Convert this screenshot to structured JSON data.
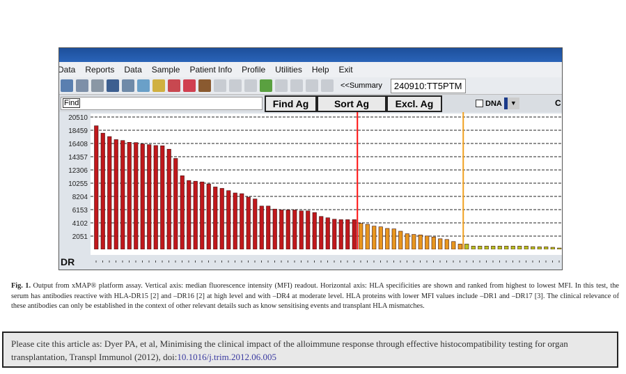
{
  "app": {
    "menu": [
      "Data",
      "Reports",
      "Data",
      "Sample",
      "Patient Info",
      "Profile",
      "Utilities",
      "Help",
      "Exit"
    ],
    "summary_label": "<<Summary",
    "sample_id": "240910:TT5PTM",
    "find_label": "Find",
    "find_value": "",
    "buttons": {
      "find_ag": "Find Ag",
      "sort_ag": "Sort Ag",
      "excl_ag": "Excl. Ag"
    },
    "dna_label": "DNA",
    "dna_checked": false,
    "cut_label": "C"
  },
  "chart_data": {
    "type": "bar",
    "ylabel": "",
    "xlabel": "DR",
    "yticks": [
      2051,
      4102,
      6153,
      8204,
      10255,
      12306,
      14357,
      16408,
      18459,
      20510
    ],
    "ylim": [
      0,
      20510
    ],
    "grid": "dashed horizontal",
    "values": [
      19150,
      18010,
      17480,
      17010,
      16870,
      16590,
      16550,
      16340,
      16230,
      16090,
      16050,
      15520,
      14090,
      11410,
      10670,
      10560,
      10450,
      10130,
      9670,
      9450,
      9100,
      8740,
      8630,
      8100,
      7810,
      6710,
      6710,
      6240,
      6100,
      6100,
      6100,
      5960,
      5960,
      5710,
      5100,
      4890,
      4670,
      4600,
      4600,
      4600,
      4020,
      3880,
      3600,
      3490,
      3240,
      3170,
      2810,
      2420,
      2310,
      2240,
      2070,
      1920,
      1640,
      1530,
      1210,
      820,
      820,
      500,
      500,
      500,
      500,
      500,
      500,
      500,
      500,
      500,
      420,
      390,
      390,
      320,
      210
    ],
    "colors": {
      "high": "#c0181c",
      "moderate": "#e8961e",
      "low": "#b8c020"
    },
    "thresholds": [
      {
        "after_bar": 40,
        "color": "#ff1010"
      },
      {
        "after_bar": 56,
        "color": "#f0a020"
      }
    ]
  },
  "caption": {
    "label": "Fig. 1.",
    "text": "Output from xMAP® platform assay. Vertical axis: median fluorescence intensity (MFI) readout. Horizontal axis: HLA specificities are shown and ranked from highest to lowest MFI. In this test, the serum has antibodies reactive with HLA-DR15 [2] and –DR16 [2] at high level and with –DR4 at moderate level. HLA proteins with lower MFI values include –DR1 and –DR17 [3]. The clinical relevance of these antibodies can only be established in the context of other relevant details such as know sensitising events and transplant HLA mismatches."
  },
  "citation": {
    "text": "Please cite this article as: Dyer PA, et al, Minimising the clinical impact of the alloimmune response through effective histocompatibility testing for organ transplantation, Transpl Immunol (2012), doi:",
    "doi": "10.1016/j.trim.2012.06.005"
  }
}
